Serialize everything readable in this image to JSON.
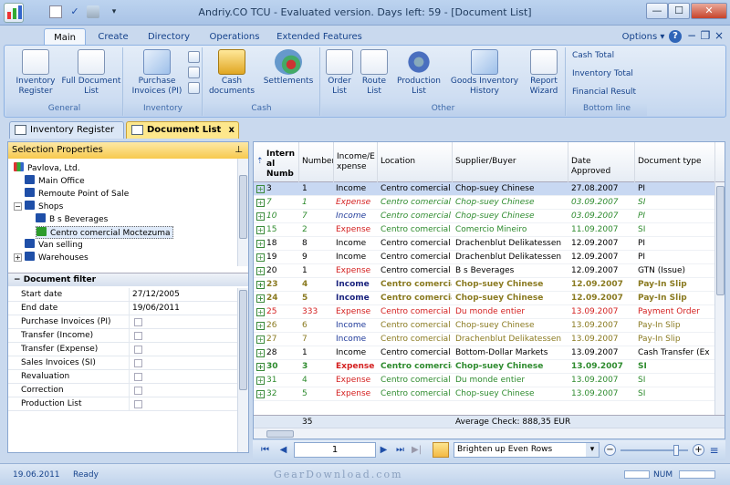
{
  "window": {
    "title": "Andriy.CO TCU - Evaluated version. Days left: 59 - [Document List]",
    "minimize": "—",
    "maximize": "☐",
    "close": "✕"
  },
  "ribbon_tabs": [
    "Main",
    "Create",
    "Directory",
    "Operations",
    "Extended Features"
  ],
  "options_label": "Options ▾",
  "help_glyph": "?",
  "groups": {
    "general": {
      "label": "General",
      "buttons": [
        "Inventory\nRegister",
        "Full Document\nList"
      ]
    },
    "inventory": {
      "label": "Inventory",
      "buttons": [
        "Purchase\nInvoices (PI)"
      ]
    },
    "cash": {
      "label": "Cash",
      "buttons": [
        "Cash\ndocuments",
        "Settlements"
      ]
    },
    "other": {
      "label": "Other",
      "buttons": [
        "Order\nList",
        "Route\nList",
        "Production\nList",
        "Goods Inventory\nHistory",
        "Report\nWizard"
      ]
    },
    "bottom_line": {
      "label": "Bottom line",
      "links": [
        "Cash Total",
        "Inventory Total",
        "Financial Result"
      ]
    }
  },
  "doc_tabs": [
    {
      "label": "Inventory Register"
    },
    {
      "label": "Document List"
    }
  ],
  "doc_tab_close": "x",
  "selection_properties": {
    "title": "Selection Properties",
    "pin": "⊥",
    "tree": [
      "Pavlova, Ltd.",
      "Main Office",
      "Remoute Point of Sale",
      "Shops",
      "B s Beverages",
      "Centro comercial Moctezuma",
      "Van selling",
      "Warehouses"
    ],
    "tree_expanders": [
      "−",
      "+"
    ]
  },
  "document_filter": {
    "title": "Document filter",
    "toggle": "−",
    "rows": [
      {
        "label": "Start date",
        "value": "27/12/2005"
      },
      {
        "label": "End date",
        "value": "19/06/2011"
      },
      {
        "label": "Purchase Invoices (PI)"
      },
      {
        "label": "Transfer (Income)"
      },
      {
        "label": "Transfer (Expense)"
      },
      {
        "label": "Sales Invoices (SI)"
      },
      {
        "label": "Revaluation"
      },
      {
        "label": "Correction"
      },
      {
        "label": "Production List"
      }
    ]
  },
  "grid": {
    "sort_glyph": "⇡",
    "expand_glyph": "+",
    "columns": [
      "Intern\nal\nNumb",
      "Number",
      "Income/E\nxpense",
      "Location",
      "Supplier/Buyer",
      "Date Approved",
      "Document type"
    ],
    "rows": [
      {
        "n": "3",
        "num": "1",
        "ie": "Income",
        "loc": "Centro comercial M",
        "sb": "Chop-suey Chinese",
        "date": "27.08.2007",
        "type": "PI",
        "style": "sel"
      },
      {
        "n": "7",
        "num": "1",
        "ie": "Expense",
        "loc": "Centro comercial",
        "sb": "Chop-suey Chinese",
        "date": "03.09.2007",
        "type": "SI",
        "style": "it"
      },
      {
        "n": "10",
        "num": "7",
        "ie": "Income",
        "loc": "Centro comercial",
        "sb": "Chop-suey Chinese",
        "date": "03.09.2007",
        "type": "PI",
        "style": "it"
      },
      {
        "n": "15",
        "num": "2",
        "ie": "Expense",
        "loc": "Centro comercial M",
        "sb": "Comercio Mineiro",
        "date": "11.09.2007",
        "type": "SI",
        "style": "g"
      },
      {
        "n": "18",
        "num": "8",
        "ie": "Income",
        "loc": "Centro comercial M",
        "sb": "Drachenblut Delikatessen",
        "date": "12.09.2007",
        "type": "PI",
        "style": "n"
      },
      {
        "n": "19",
        "num": "9",
        "ie": "Income",
        "loc": "Centro comercial M",
        "sb": "Drachenblut Delikatessen",
        "date": "12.09.2007",
        "type": "PI",
        "style": "n"
      },
      {
        "n": "20",
        "num": "1",
        "ie": "Expense",
        "loc": "Centro comercial M",
        "sb": "B s Beverages",
        "date": "12.09.2007",
        "type": "GTN (Issue)",
        "style": "n"
      },
      {
        "n": "23",
        "num": "4",
        "ie": "Income",
        "loc": "Centro comercia",
        "sb": "Chop-suey Chinese",
        "date": "12.09.2007",
        "type": "Pay-In Slip",
        "style": "b"
      },
      {
        "n": "24",
        "num": "5",
        "ie": "Income",
        "loc": "Centro comercia",
        "sb": "Chop-suey Chinese",
        "date": "12.09.2007",
        "type": "Pay-In Slip",
        "style": "b"
      },
      {
        "n": "25",
        "num": "333",
        "ie": "Expense",
        "loc": "Centro comercial M",
        "sb": "Du monde entier",
        "date": "13.09.2007",
        "type": "Payment Order",
        "style": "r"
      },
      {
        "n": "26",
        "num": "6",
        "ie": "Income",
        "loc": "Centro comercial M",
        "sb": "Chop-suey Chinese",
        "date": "13.09.2007",
        "type": "Pay-In Slip",
        "style": "o"
      },
      {
        "n": "27",
        "num": "7",
        "ie": "Income",
        "loc": "Centro comercial M",
        "sb": "Drachenblut Delikatessen",
        "date": "13.09.2007",
        "type": "Pay-In Slip",
        "style": "o"
      },
      {
        "n": "28",
        "num": "1",
        "ie": "Income",
        "loc": "Centro comercial M",
        "sb": "Bottom-Dollar Markets",
        "date": "13.09.2007",
        "type": "Cash Transfer (Ex",
        "style": "n"
      },
      {
        "n": "30",
        "num": "3",
        "ie": "Expense",
        "loc": "Centro comercia",
        "sb": "Chop-suey Chinese",
        "date": "13.09.2007",
        "type": "SI",
        "style": "gb"
      },
      {
        "n": "31",
        "num": "4",
        "ie": "Expense",
        "loc": "Centro comercial M",
        "sb": "Du monde entier",
        "date": "13.09.2007",
        "type": "SI",
        "style": "g"
      },
      {
        "n": "32",
        "num": "5",
        "ie": "Expense",
        "loc": "Centro comercial M",
        "sb": "Chop-suey Chinese",
        "date": "13.09.2007",
        "type": "SI",
        "style": "g"
      }
    ],
    "footer": {
      "count": "35",
      "avg": "Average Check: 888,35 EUR"
    }
  },
  "navbar": {
    "page": "1",
    "highlight": "Brighten up Even Rows",
    "dropdown_glyph": "▾",
    "zoom_out": "−",
    "zoom_in": "+",
    "zoom_level": 0.85,
    "nav_glyphs": {
      "first": "⏮",
      "prev": "◀",
      "next": "▶",
      "last": "⏭",
      "extra": "▶|",
      "menu": "≡"
    }
  },
  "status": {
    "date": "19.06.2011",
    "state": "Ready",
    "num": "NUM",
    "watermark": "GearDownload.com"
  },
  "colors": {
    "ribbon_border": "#8db2e3",
    "income": "#1f3a9a",
    "expense": "#d42020",
    "green": "#2e8b2e",
    "olive": "#8a7a20",
    "bold_blue": "#1a237e",
    "selected_row": "#c8d8f2"
  }
}
